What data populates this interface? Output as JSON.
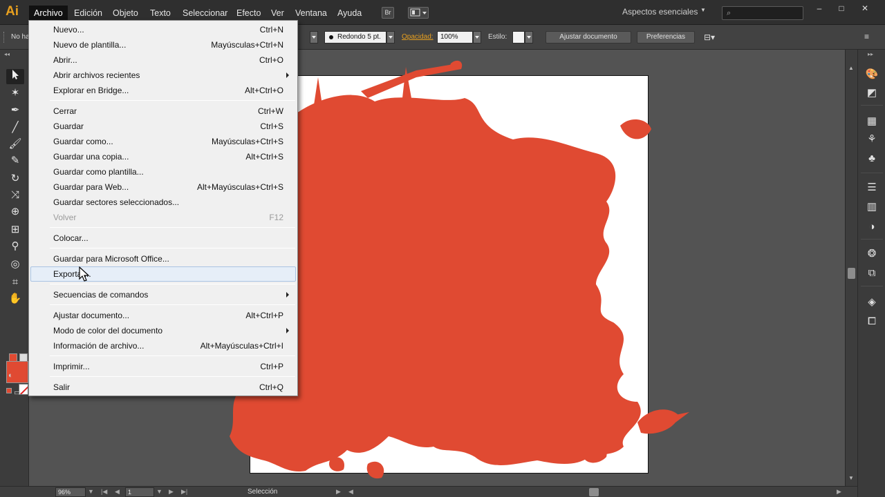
{
  "app": {
    "logo": "Ai",
    "menus": [
      "Archivo",
      "Edición",
      "Objeto",
      "Texto",
      "Seleccionar",
      "Efecto",
      "Ver",
      "Ventana",
      "Ayuda"
    ],
    "bridge_button": "Br",
    "workspace": "Aspectos esenciales",
    "search_placeholder": "",
    "window_controls": [
      "–",
      "□",
      "✕"
    ]
  },
  "control_bar": {
    "selection_text": "No ha",
    "brush_label": "Redondo 5 pt.",
    "opacity_label": "Opacidad:",
    "opacity_value": "100%",
    "style_label": "Estilo:",
    "document_setup_button": "Ajustar documento",
    "preferences_button": "Preferencias"
  },
  "colors": {
    "fill": "#e04a32",
    "accent": "#e8a01f",
    "splat": "#e04a32"
  },
  "file_menu": {
    "items": [
      {
        "label": "Nuevo...",
        "shortcut": "Ctrl+N"
      },
      {
        "label": "Nuevo de plantilla...",
        "shortcut": "Mayúsculas+Ctrl+N"
      },
      {
        "label": "Abrir...",
        "shortcut": "Ctrl+O"
      },
      {
        "label": "Abrir archivos recientes",
        "shortcut": ""
      },
      {
        "label": "Explorar en Bridge...",
        "shortcut": "Alt+Ctrl+O"
      },
      {
        "label": "Cerrar",
        "shortcut": "Ctrl+W"
      },
      {
        "label": "Guardar",
        "shortcut": "Ctrl+S"
      },
      {
        "label": "Guardar como...",
        "shortcut": "Mayúsculas+Ctrl+S"
      },
      {
        "label": "Guardar una copia...",
        "shortcut": "Alt+Ctrl+S"
      },
      {
        "label": "Guardar como plantilla...",
        "shortcut": ""
      },
      {
        "label": "Guardar para Web...",
        "shortcut": "Alt+Mayúsculas+Ctrl+S"
      },
      {
        "label": "Guardar sectores seleccionados...",
        "shortcut": ""
      },
      {
        "label": "Volver",
        "shortcut": "F12"
      },
      {
        "label": "Colocar...",
        "shortcut": ""
      },
      {
        "label": "Guardar para Microsoft Office...",
        "shortcut": ""
      },
      {
        "label": "Exportar...",
        "shortcut": ""
      },
      {
        "label": "Secuencias de comandos",
        "shortcut": ""
      },
      {
        "label": "Ajustar documento...",
        "shortcut": "Alt+Ctrl+P"
      },
      {
        "label": "Modo de color del documento",
        "shortcut": ""
      },
      {
        "label": "Información de archivo...",
        "shortcut": "Alt+Mayúsculas+Ctrl+I"
      },
      {
        "label": "Imprimir...",
        "shortcut": "Ctrl+P"
      },
      {
        "label": "Salir",
        "shortcut": "Ctrl+Q"
      }
    ]
  },
  "status_bar": {
    "zoom": "96%",
    "artboard_number": "1",
    "status_text": "Selección"
  },
  "tool_icons": [
    "selection-tool-icon",
    "magic-wand-icon",
    "pen-tool-icon",
    "line-tool-icon",
    "brush-tool-icon",
    "eraser-tool-icon",
    "rotate-tool-icon",
    "warp-tool-icon",
    "shape-builder-icon",
    "mesh-tool-icon",
    "eyedropper-icon",
    "symbol-sprayer-icon",
    "artboard-tool-icon",
    "hand-tool-icon"
  ],
  "dock_icons": [
    "color-panel-icon",
    "color-guide-icon",
    "swatches-icon",
    "brushes-icon",
    "symbols-icon",
    "stroke-icon",
    "gradient-icon",
    "transparency-icon",
    "appearance-icon",
    "graphic-styles-icon",
    "layers-icon",
    "artboards-icon"
  ]
}
